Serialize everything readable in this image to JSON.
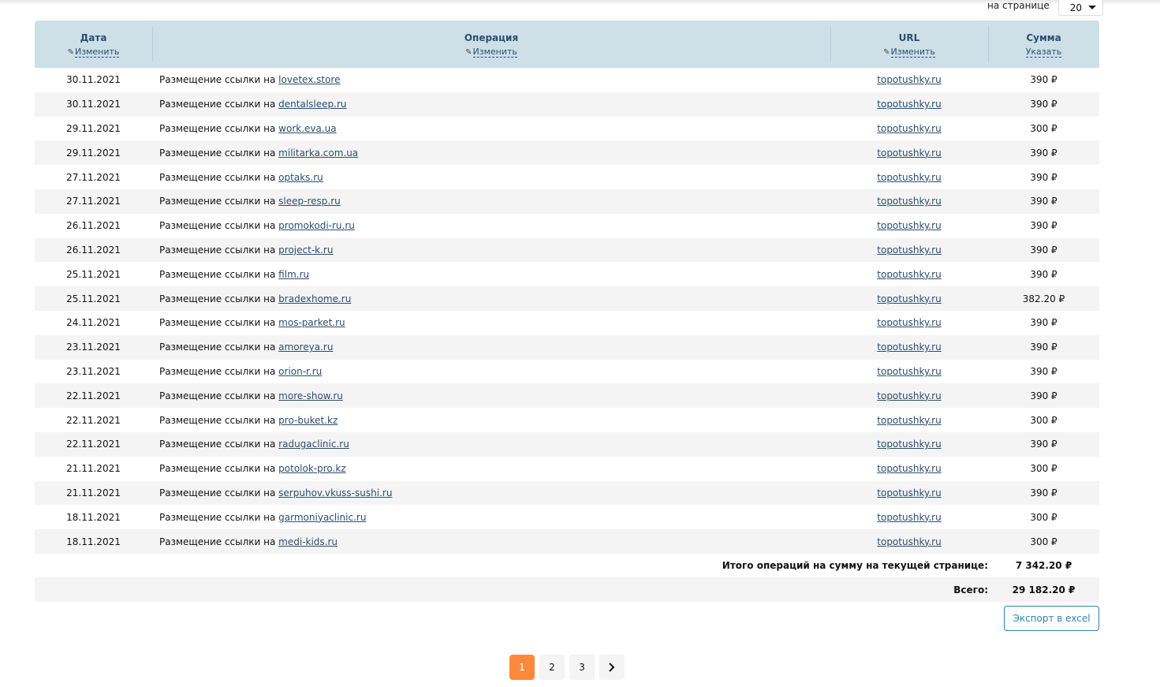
{
  "per_page": {
    "label": "на странице",
    "value": "20"
  },
  "table": {
    "headers": {
      "date": {
        "title": "Дата",
        "action": "Изменить"
      },
      "operation": {
        "title": "Операция",
        "action": "Изменить"
      },
      "url": {
        "title": "URL",
        "action": "Изменить"
      },
      "sum": {
        "title": "Сумма",
        "action": "Указать"
      }
    },
    "op_prefix": "Размещение ссылки на",
    "rows": [
      {
        "date": "30.11.2021",
        "site": "lovetex.store",
        "url": "topotushky.ru",
        "sum": "390 ₽"
      },
      {
        "date": "30.11.2021",
        "site": "dentalsleep.ru",
        "url": "topotushky.ru",
        "sum": "390 ₽"
      },
      {
        "date": "29.11.2021",
        "site": "work.eva.ua",
        "url": "topotushky.ru",
        "sum": "300 ₽"
      },
      {
        "date": "29.11.2021",
        "site": "militarka.com.ua",
        "url": "topotushky.ru",
        "sum": "390 ₽"
      },
      {
        "date": "27.11.2021",
        "site": "optaks.ru",
        "url": "topotushky.ru",
        "sum": "390 ₽"
      },
      {
        "date": "27.11.2021",
        "site": "sleep-resp.ru",
        "url": "topotushky.ru",
        "sum": "390 ₽"
      },
      {
        "date": "26.11.2021",
        "site": "promokodi-ru.ru",
        "url": "topotushky.ru",
        "sum": "390 ₽"
      },
      {
        "date": "26.11.2021",
        "site": "project-k.ru",
        "url": "topotushky.ru",
        "sum": "390 ₽"
      },
      {
        "date": "25.11.2021",
        "site": "film.ru",
        "url": "topotushky.ru",
        "sum": "390 ₽"
      },
      {
        "date": "25.11.2021",
        "site": "bradexhome.ru",
        "url": "topotushky.ru",
        "sum": "382.20 ₽"
      },
      {
        "date": "24.11.2021",
        "site": "mos-parket.ru",
        "url": "topotushky.ru",
        "sum": "390 ₽"
      },
      {
        "date": "23.11.2021",
        "site": "amoreya.ru",
        "url": "topotushky.ru",
        "sum": "390 ₽"
      },
      {
        "date": "23.11.2021",
        "site": "orion-r.ru",
        "url": "topotushky.ru",
        "sum": "390 ₽"
      },
      {
        "date": "22.11.2021",
        "site": "more-show.ru",
        "url": "topotushky.ru",
        "sum": "390 ₽"
      },
      {
        "date": "22.11.2021",
        "site": "pro-buket.kz",
        "url": "topotushky.ru",
        "sum": "300 ₽"
      },
      {
        "date": "22.11.2021",
        "site": "radugaclinic.ru",
        "url": "topotushky.ru",
        "sum": "390 ₽"
      },
      {
        "date": "21.11.2021",
        "site": "potolok-pro.kz",
        "url": "topotushky.ru",
        "sum": "300 ₽"
      },
      {
        "date": "21.11.2021",
        "site": "serpuhov.vkuss-sushi.ru",
        "url": "topotushky.ru",
        "sum": "390 ₽"
      },
      {
        "date": "18.11.2021",
        "site": "garmoniyaclinic.ru",
        "url": "topotushky.ru",
        "sum": "300 ₽"
      },
      {
        "date": "18.11.2021",
        "site": "medi-kids.ru",
        "url": "topotushky.ru",
        "sum": "300 ₽"
      }
    ],
    "page_total": {
      "label": "Итого операций на сумму на текущей странице:",
      "value": "7 342.20 ₽"
    },
    "grand_total": {
      "label": "Всего:",
      "value": "29 182.20 ₽"
    }
  },
  "export_label": "Экспорт в excel",
  "pagination": {
    "pages": [
      "1",
      "2",
      "3"
    ],
    "current": "1",
    "next_icon": "chevron-right-icon"
  },
  "colors": {
    "header_bg": "#cde0e8",
    "accent": "#fd8a3c",
    "link": "#2d4e6e",
    "export": "#2a86b0"
  }
}
